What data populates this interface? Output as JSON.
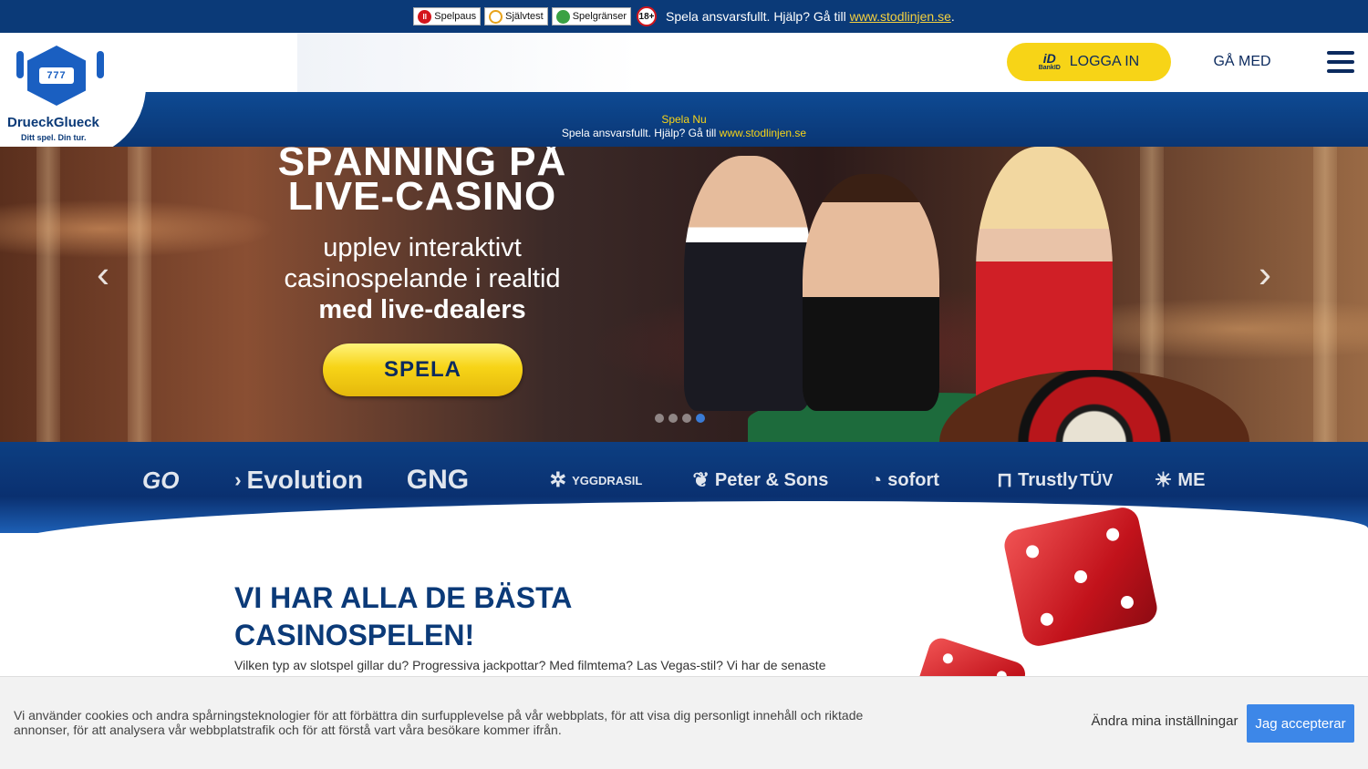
{
  "rg_bar": {
    "spelpaus": "Spelpaus",
    "sjalvtest": "Självtest",
    "spelgranser": "Spelgränser",
    "age": "18+",
    "text": "Spela ansvarsfullt. Hjälp? Gå till ",
    "link": "www.stodlinjen.se",
    "period": "."
  },
  "logo": {
    "reels": "777",
    "name": "DrueckGlueck",
    "tagline": "Ditt spel. Din tur."
  },
  "header": {
    "bankid_text": "BankID",
    "login_label": "LOGGA IN",
    "join_label": "GÅ MED"
  },
  "promo_strip": {
    "line1": "Spela Nu",
    "line2": "Spela ansvarsfullt. Hjälp? Gå till ",
    "link": "www.stodlinjen.se"
  },
  "hero": {
    "title_line1": "SPÄNNING PÅ",
    "title_line2": "LIVE-CASINO",
    "sub_line1": "upplev interaktivt",
    "sub_line2": "casinospelande i realtid",
    "sub_line3": "med live-dealers",
    "cta_label": "SPELA",
    "prev_icon": "‹",
    "next_icon": "›",
    "active_slide": 4
  },
  "providers": [
    {
      "name": "GO",
      "icon": "play-go-icon"
    },
    {
      "name": "Evolution",
      "icon": "evolution-icon"
    },
    {
      "name": "GNG",
      "icon": "gng-icon"
    },
    {
      "name": "YGGDRASIL",
      "icon": "yggdrasil-icon"
    },
    {
      "name": "Peter & Sons",
      "icon": "peter-sons-icon"
    },
    {
      "name": "sofort",
      "icon": "sofort-icon"
    },
    {
      "name": "Trustly",
      "icon": "trustly-icon"
    },
    {
      "name": "TÜV",
      "icon": "tuv-icon"
    },
    {
      "name": "ME",
      "icon": "merkur-icon"
    }
  ],
  "content": {
    "title": "VI HAR ALLA DE BÄSTA CASINOSPELEN!",
    "text": "Vilken typ av slotspel gillar du? Progressiva jackpottar? Med filmtema? Las Vegas-stil? Vi har de senaste"
  },
  "cookie": {
    "text": "Vi använder cookies och andra spårningsteknologier för att förbättra din surfupplevelse på vår webbplats, för att visa dig personligt innehåll och riktade annonser, för att analysera vår webbplatstrafik och för att förstå vart våra besökare kommer ifrån.",
    "settings_label": "Ändra mina inställningar",
    "accept_label": "Jag accepterar"
  }
}
